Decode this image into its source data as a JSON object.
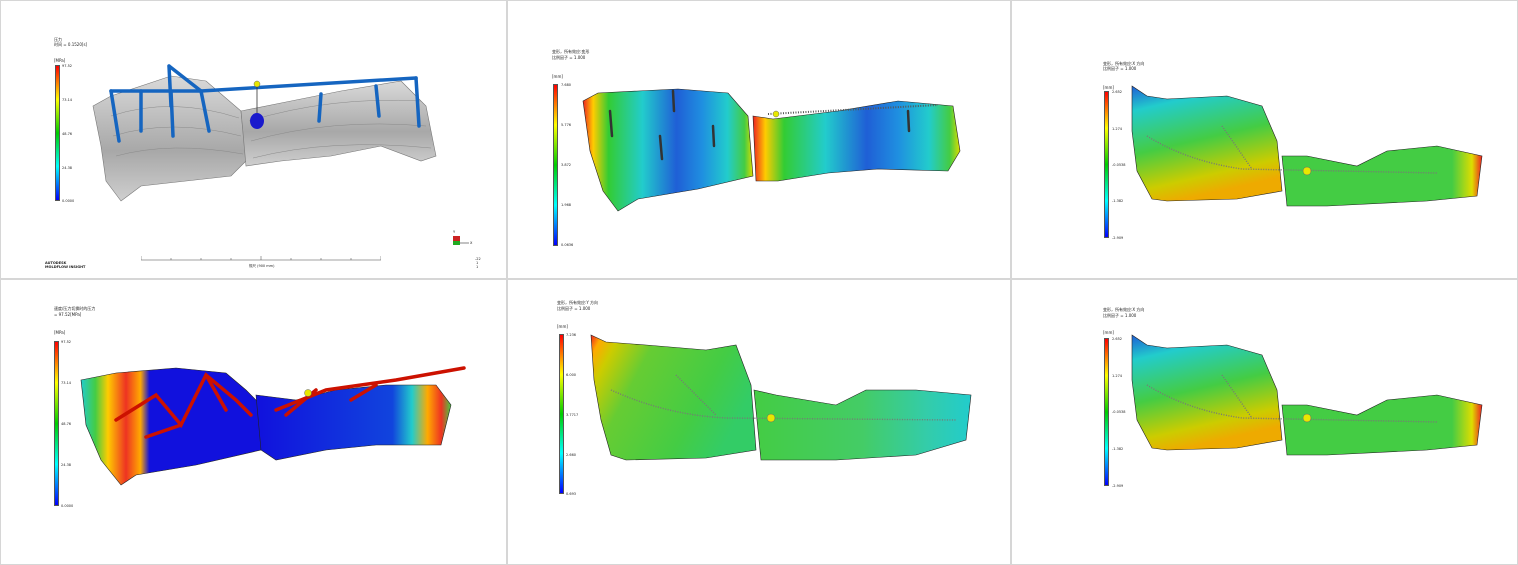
{
  "panels": [
    {
      "title": "压力",
      "subtitle": "时间 = 0.1520[s]",
      "unit": "[MPa]",
      "ticks": [
        "97.52",
        "73.14",
        "48.76",
        "24.38",
        "0.0000"
      ],
      "footer_line1": "AUTODESK",
      "footer_line2": "MOLDFLOW INSIGHT",
      "scale_label": "规尺 (900 mm)",
      "triad": {
        "y": "Y",
        "x": "X",
        "extra": [
          "-22",
          "1",
          "1"
        ]
      }
    },
    {
      "title": "变形，所有效应:变形",
      "subtitle": "比例因子 = 1.000",
      "unit": "[mm]",
      "ticks": [
        "7.680",
        "5.776",
        "3.872",
        "1.968",
        "0.0636"
      ]
    },
    {
      "title": "变形，所有效应:X 方向",
      "subtitle": "比例因子 = 1.000",
      "unit": "[mm]",
      "ticks": [
        "2.652",
        "1.274",
        "-0.0538",
        "-1.382",
        "-2.909"
      ]
    },
    {
      "title": "速度/压力切换时的压力",
      "subtitle": "= 97.52[MPa]",
      "unit": "[MPa]",
      "ticks": [
        "97.52",
        "73.14",
        "48.76",
        "24.38",
        "0.0000"
      ]
    },
    {
      "title": "变形，所有效应:Y 方向",
      "subtitle": "比例因子 = 1.000",
      "unit": "[mm]",
      "ticks": [
        "7.236",
        "6.000",
        "3.7717",
        "2.660",
        "0.693"
      ]
    },
    {
      "title": "变形，所有效应:X 方向",
      "subtitle": "比例因子 = 1.000",
      "unit": "[mm]",
      "ticks": [
        "2.652",
        "1.274",
        "-0.0538",
        "-1.382",
        "-2.909"
      ]
    }
  ]
}
